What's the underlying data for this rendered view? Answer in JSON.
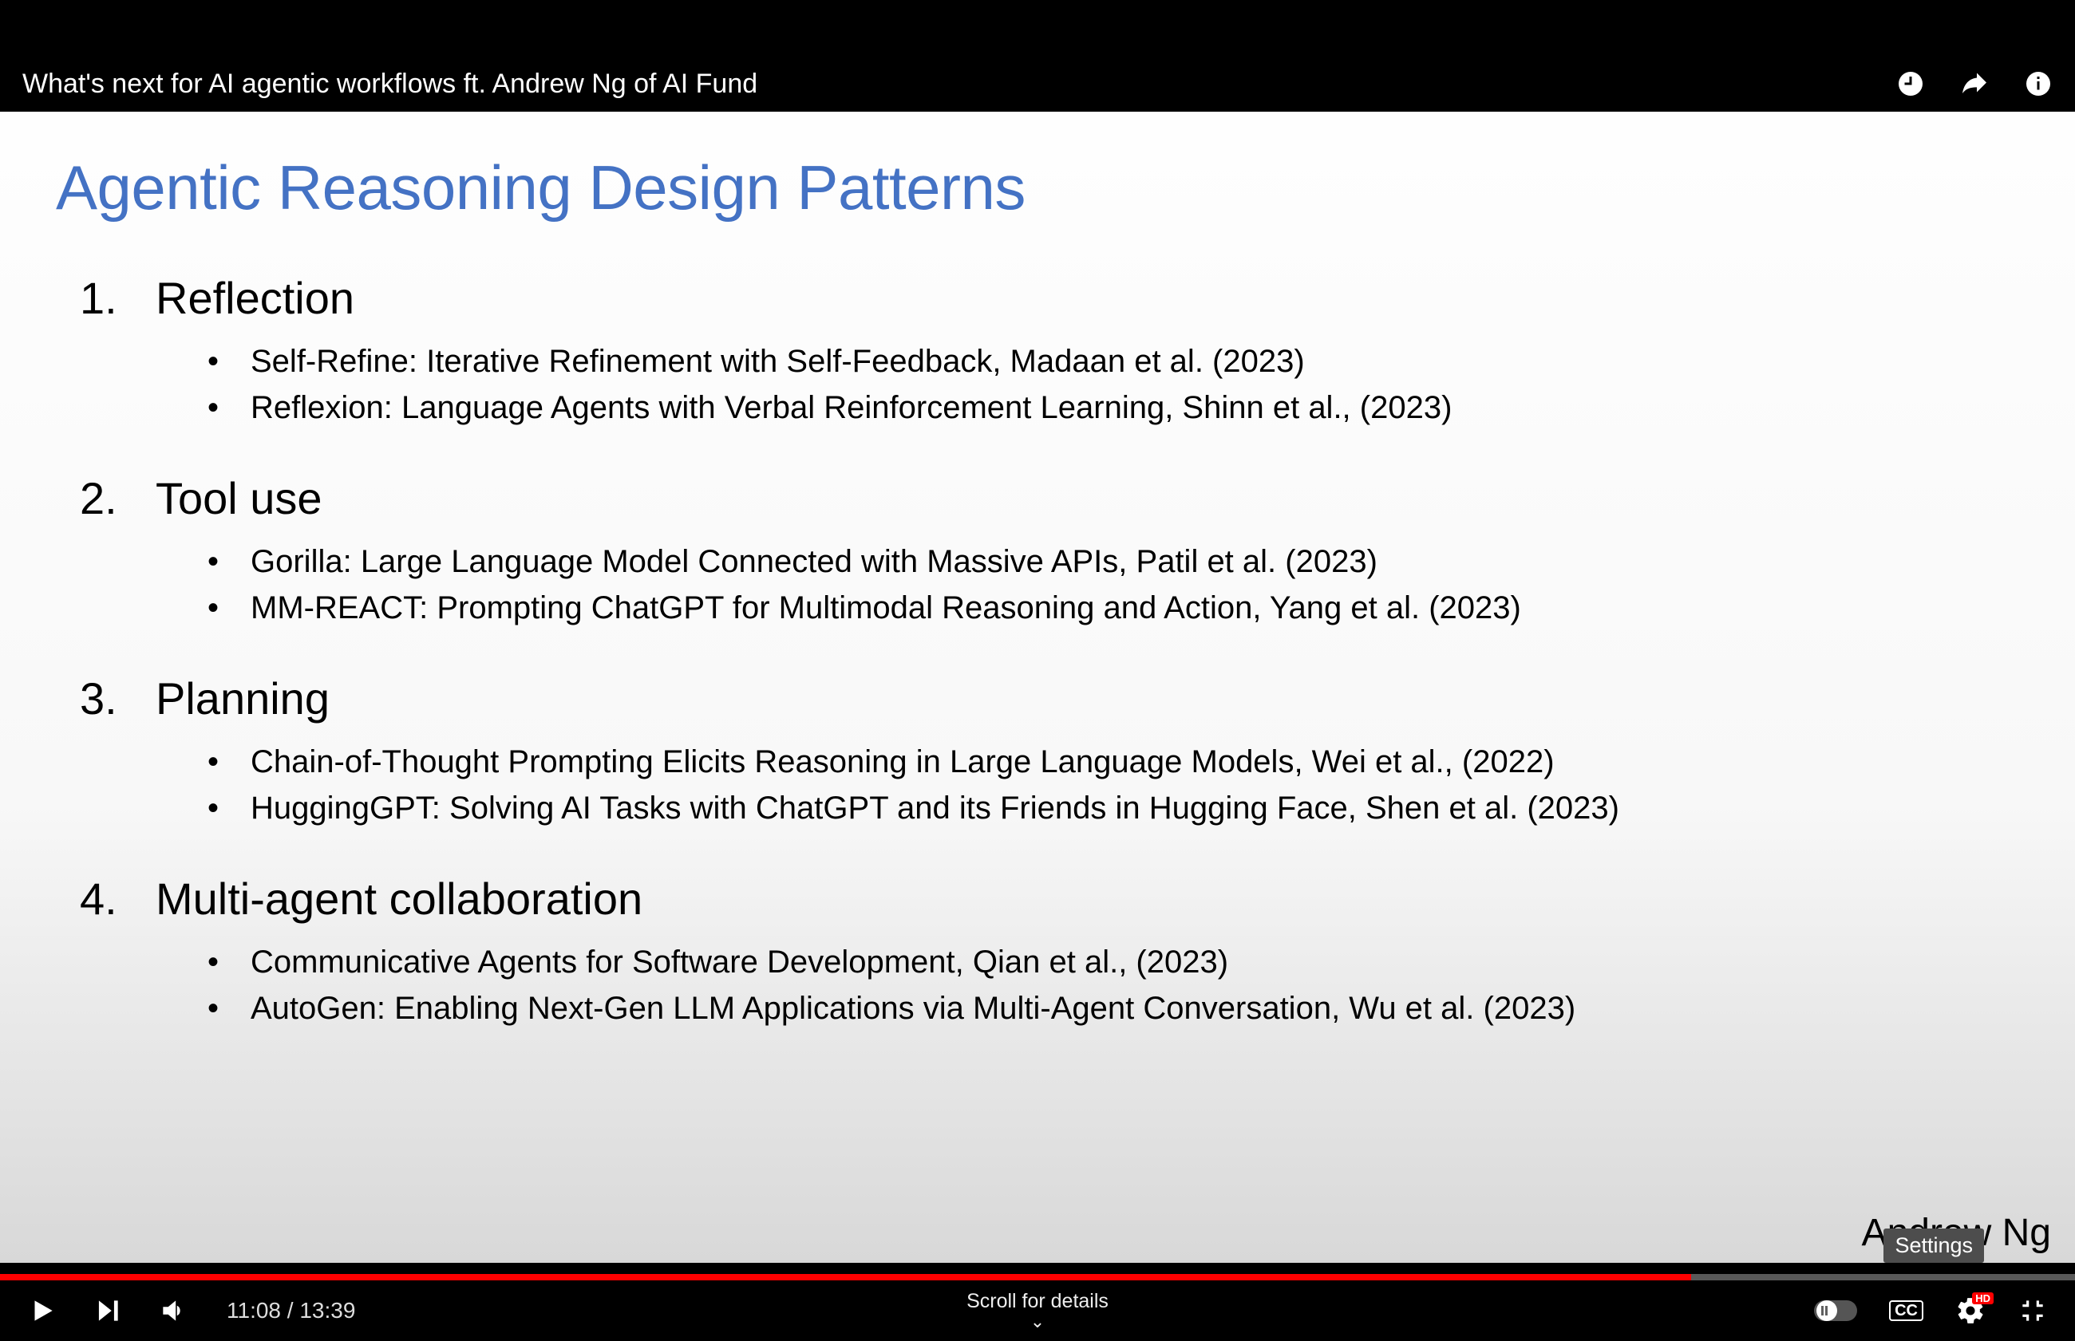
{
  "video": {
    "title": "What's next for AI agentic workflows ft. Andrew Ng of AI Fund",
    "current_time": "11:08",
    "duration": "13:39",
    "progress_percent": 81.5
  },
  "scroll_hint": "Scroll for details",
  "tooltip": "Settings",
  "hd_label": "HD",
  "cc_label": "CC",
  "slide": {
    "title": "Agentic Reasoning Design Patterns",
    "speaker": "Andrew Ng",
    "patterns": [
      {
        "name": "Reflection",
        "papers": [
          "Self-Refine: Iterative Refinement with Self-Feedback, Madaan et al. (2023)",
          "Reflexion: Language Agents with Verbal Reinforcement Learning, Shinn et al., (2023)"
        ]
      },
      {
        "name": "Tool use",
        "papers": [
          "Gorilla: Large Language Model Connected with Massive APIs, Patil et al. (2023)",
          "MM-REACT: Prompting ChatGPT for Multimodal Reasoning and Action, Yang et al. (2023)"
        ]
      },
      {
        "name": "Planning",
        "papers": [
          "Chain-of-Thought Prompting Elicits Reasoning in Large Language Models, Wei et al., (2022)",
          "HuggingGPT: Solving AI Tasks with ChatGPT and its Friends in Hugging Face, Shen et al. (2023)"
        ]
      },
      {
        "name": "Multi-agent collaboration",
        "papers": [
          "Communicative Agents for Software Development, Qian et al., (2023)",
          "AutoGen: Enabling Next-Gen LLM Applications via Multi-Agent Conversation, Wu et al. (2023)"
        ]
      }
    ]
  }
}
